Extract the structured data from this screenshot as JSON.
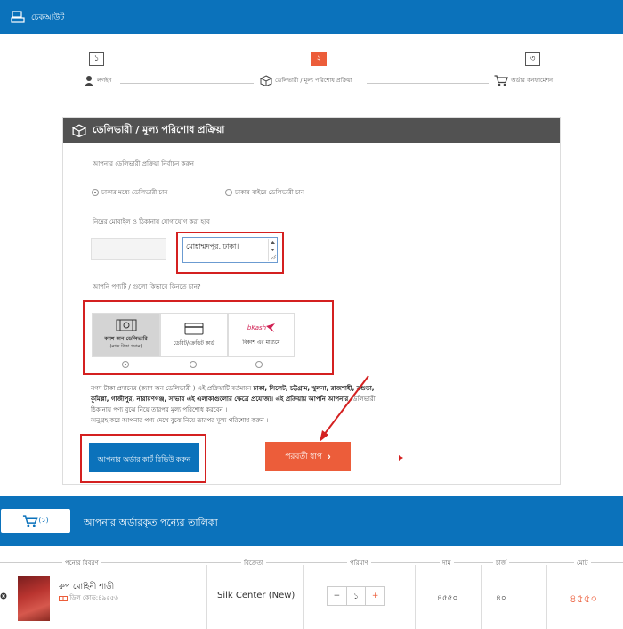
{
  "header": {
    "title": "চেকআউট"
  },
  "steps": [
    {
      "number": "১",
      "label": "লগইন"
    },
    {
      "number": "২",
      "label": "ডেলিভারী / মূল্য পরিশোধ প্রক্রিয়া"
    },
    {
      "number": "৩",
      "label": "অর্ডার কনফার্মেশন"
    }
  ],
  "panel": {
    "title": "ডেলিভারী / মূল্য পরিশোধ প্রক্রিয়া",
    "delivery_prompt": "আপনার ডেলিভারী প্রক্রিয়া নির্বাচন করুন",
    "delivery_options": [
      "ঢাকার মধ্যে ডেলিভারী চান",
      "ঢাকার বাইরে ডেলিভারী চান"
    ],
    "contact_note": "নিম্নের মোবাইল ও ঠিকানায় যোগাযোগ করা হবে",
    "address_value": "মোহাম্মদপুর, ঢাকা।",
    "payment_prompt": "আপনি পণ্যটি / গুলো কিভাবে কিনতে চান?",
    "payment_options": [
      {
        "line1": "ক্যাশ অন ডেলিভারি",
        "line2": "(নগদ টাকা প্রদান)"
      },
      {
        "line1": "ডেবিট/ক্রেডিট কার্ড",
        "line2": ""
      },
      {
        "line1": "বিকাশ এর মাধ্যমে",
        "line2": ""
      }
    ],
    "bkash_logo": "bKash",
    "description": {
      "p1": "নগদ টাকা প্রদানের (ক্যাশ অন ডেলিভারী ) এই প্রক্রিয়াটি বর্তমানে ",
      "cities": "ঢাকা, সিলেট, চট্টগ্রাম, খুলনা, রাজশাহী, বগুড়া, কুমিল্লা, গাজীপুর, নারায়ণগঞ্জ, সাভার এই এলাকাগুলোর ক্ষেত্রে প্রযোজ্য। এই প্রক্রিয়ায় আপনি আপনার",
      "p2": " ডেলিভারী ঠিকানায় পণ্য বুঝে নিয়ে তারপর মূল্য পরিশোধ করবেন ।",
      "p3": "অনুগ্রহ করে আপনার পণ্য দেখে বুঝে নিয়ে তারপর মূল্য পরিশোধ করুন ।"
    },
    "review_button": "আপনার অর্ডার কার্ট রিভিউ করুন",
    "next_button": "পরবর্তী ধাপ"
  },
  "cart": {
    "count": "(১)",
    "title": "আপনার অর্ডারকৃত পন্যের তালিকা",
    "headers": [
      "পন্যের বিবরণ",
      "বিক্রেতা",
      "পরিমাণ",
      "দাম",
      "চার্জ",
      "মোট"
    ],
    "item": {
      "name": "রুপ মোহিনী শাড়ী",
      "code": "ডিল কোড:৪৯৫৫৬",
      "seller": "Silk Center (New)",
      "qty": "১",
      "price": "৪৫৫০",
      "charge": "৪০",
      "total": "৪৫৫০"
    }
  },
  "colors": {
    "primary": "#0b72bb",
    "accent": "#ec5d3a",
    "highlight": "#d42020",
    "panel_head": "#525252"
  }
}
